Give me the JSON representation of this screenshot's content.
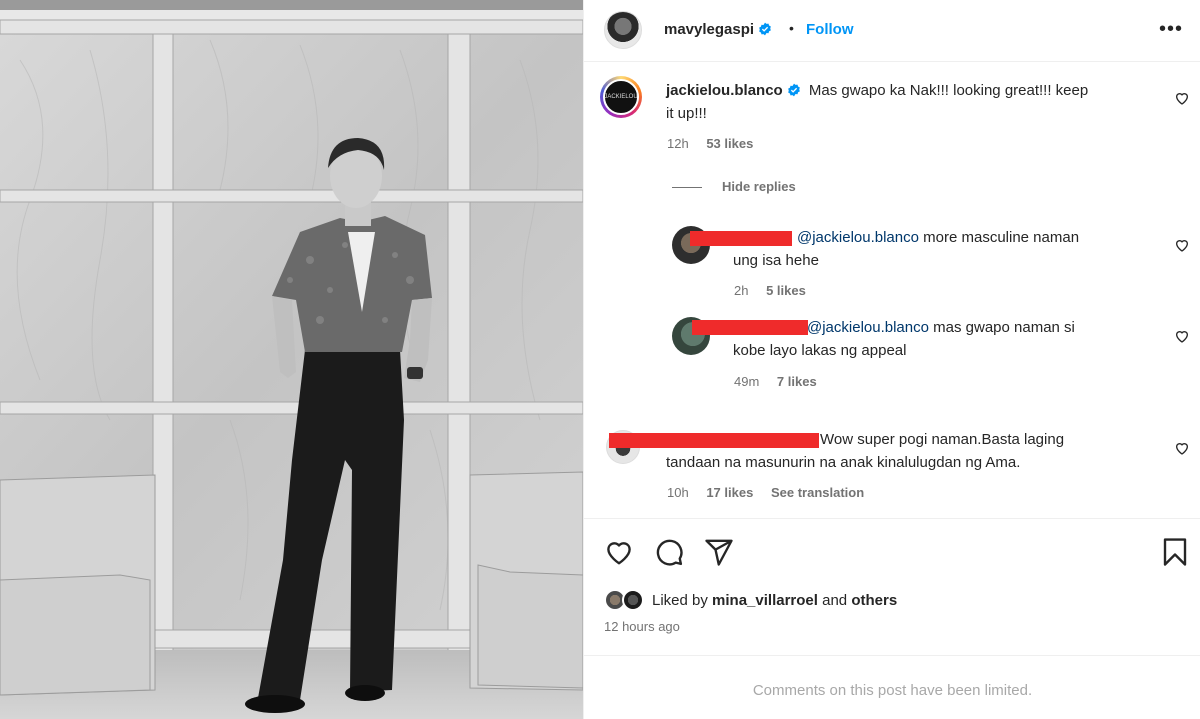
{
  "post": {
    "owner": "mavylegaspi",
    "follow_label": "Follow",
    "separator": "•",
    "more_label": "•••"
  },
  "comments": [
    {
      "username": "jackielou.blanco",
      "verified": true,
      "text_line1": "Mas gwapo ka Nak!!! looking great!!! keep",
      "text_line2": "it up!!!",
      "time": "12h",
      "likes": "53 likes",
      "avatar_text": "JACKIELOU"
    }
  ],
  "hide_replies_label": "Hide replies",
  "replies": [
    {
      "mention": "@jackielou.blanco",
      "text_line1": "more masculine naman",
      "text_line2": "ung isa hehe",
      "time": "2h",
      "likes": "5 likes"
    },
    {
      "mention": "@jackielou.blanco",
      "text_line1": "mas gwapo naman si",
      "text_line2": "kobe layo lakas ng appeal",
      "time": "49m",
      "likes": "7 likes"
    }
  ],
  "comment2": {
    "text_line1": "Wow super pogi naman.Basta laging",
    "text_line2": "tandaan na masunurin na anak kinalulugdan ng Ama.",
    "time": "10h",
    "likes": "17 likes",
    "translate": "See translation"
  },
  "likes_summary": {
    "prefix": "Liked by",
    "user": "mina_villarroel",
    "connector": "and",
    "suffix": "others"
  },
  "posted_time": "12 hours ago",
  "comments_limited": "Comments on this post have been limited.",
  "colors": {
    "accent": "#0095f6",
    "verified": "#0095f6",
    "redaction": "#ef2b2b",
    "muted": "#737373"
  },
  "icons": [
    "heart-icon",
    "comment-icon",
    "share-icon",
    "bookmark-icon",
    "more-icon",
    "verified-badge-icon"
  ]
}
